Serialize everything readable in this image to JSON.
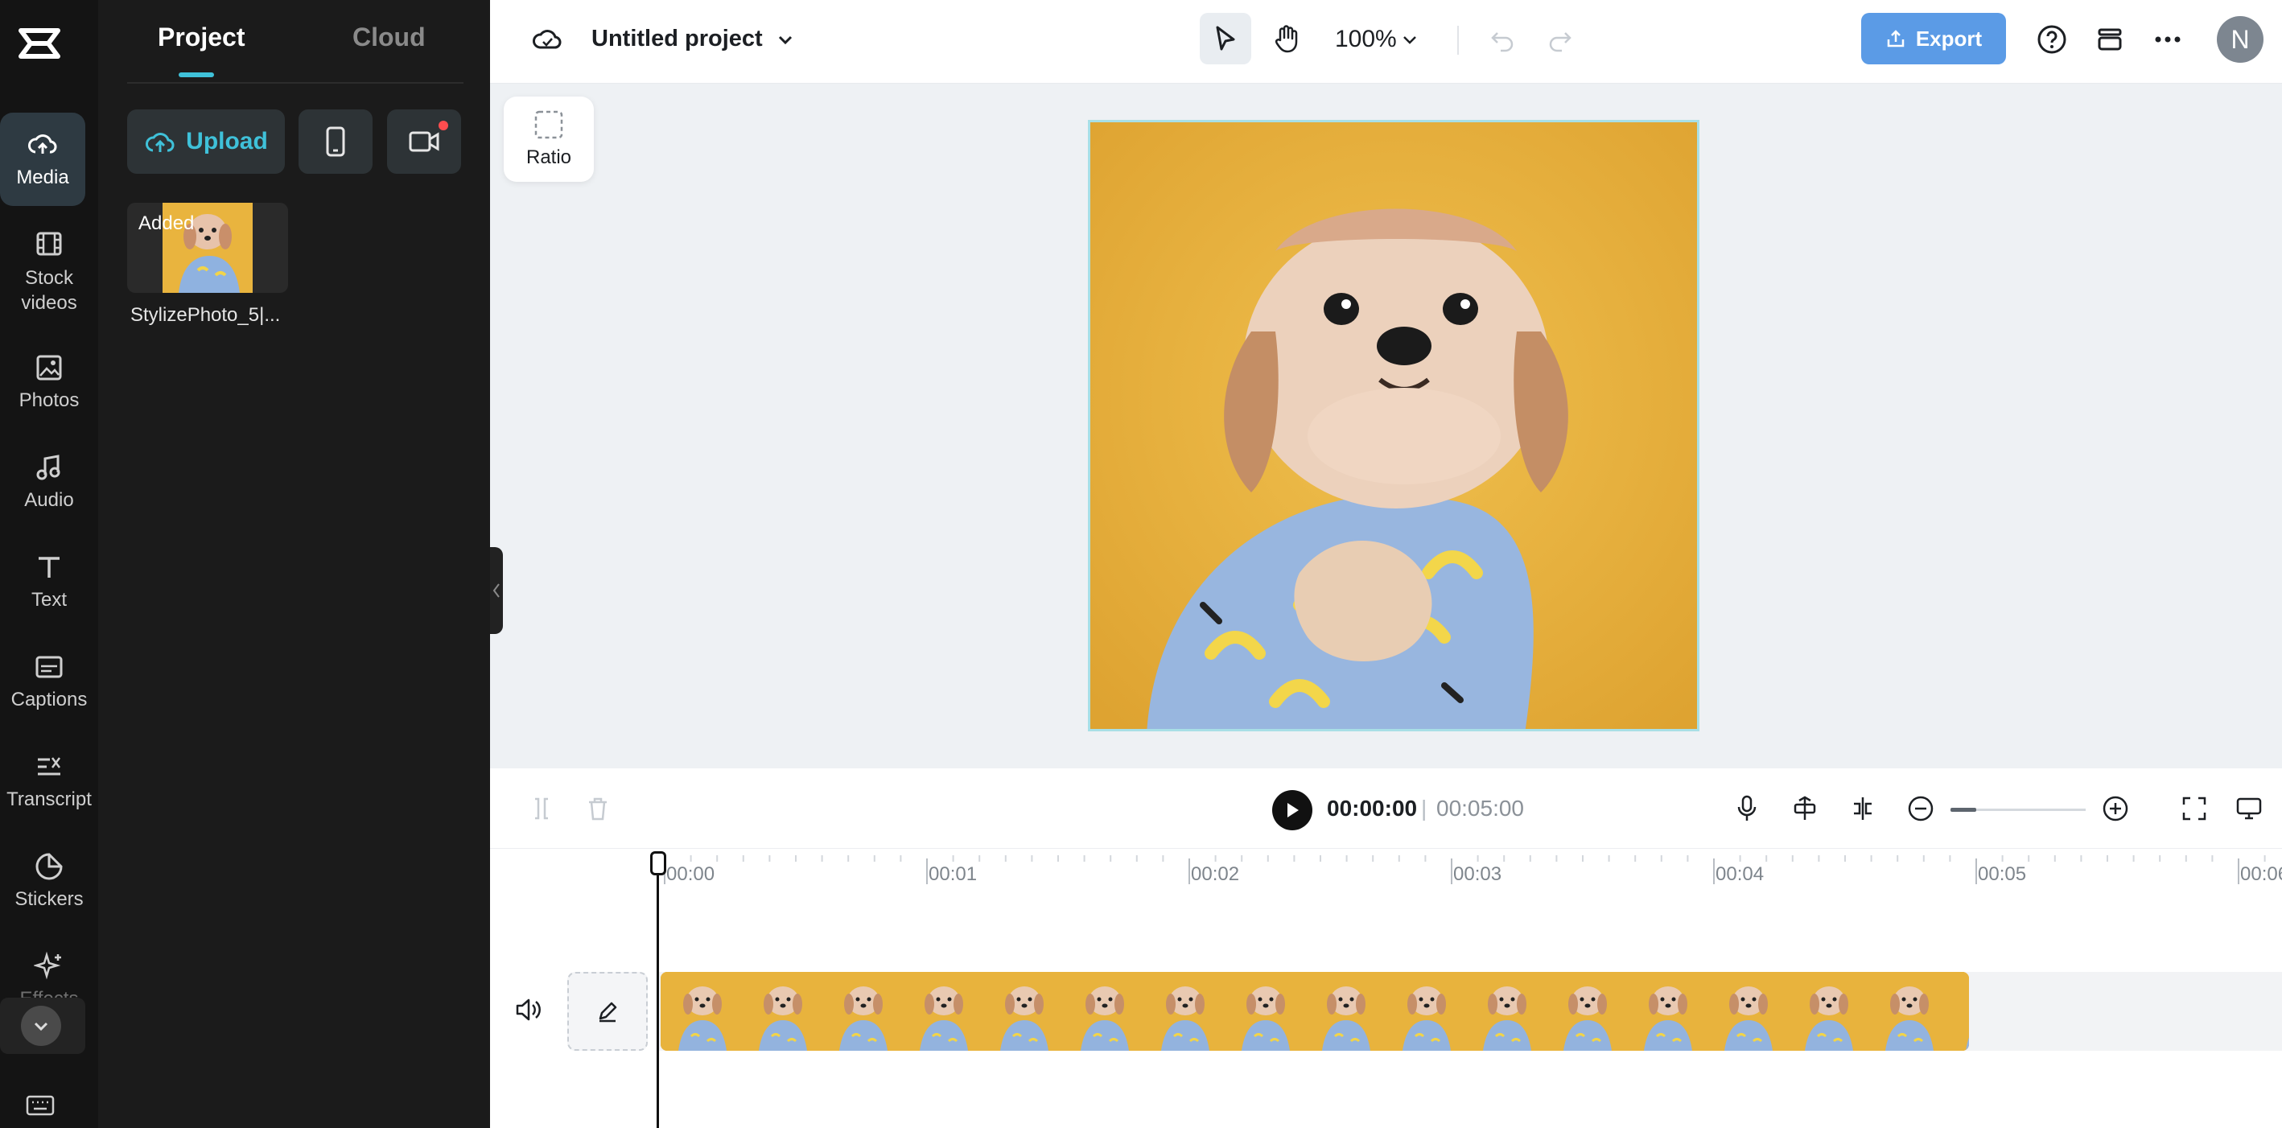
{
  "sidebar": {
    "items": [
      {
        "id": "media",
        "label": "Media",
        "icon": "cloud-upload-icon"
      },
      {
        "id": "stock-videos",
        "label": "Stock\nvideos",
        "icon": "film-icon"
      },
      {
        "id": "photos",
        "label": "Photos",
        "icon": "image-icon"
      },
      {
        "id": "audio",
        "label": "Audio",
        "icon": "music-note-icon"
      },
      {
        "id": "text",
        "label": "Text",
        "icon": "text-t-icon"
      },
      {
        "id": "captions",
        "label": "Captions",
        "icon": "captions-icon"
      },
      {
        "id": "transcript",
        "label": "Transcript",
        "icon": "transcript-icon"
      },
      {
        "id": "stickers",
        "label": "Stickers",
        "icon": "sticker-icon"
      },
      {
        "id": "effects",
        "label": "Effects",
        "icon": "sparkle-icon"
      }
    ],
    "active": "media"
  },
  "media_panel": {
    "tabs": [
      "Project",
      "Cloud"
    ],
    "active_tab": "Project",
    "upload_label": "Upload",
    "assets": [
      {
        "name": "StylizePhoto_5|...",
        "badge": "Added"
      }
    ]
  },
  "topbar": {
    "project_title": "Untitled project",
    "zoom": "100%",
    "export_label": "Export",
    "avatar_initial": "N"
  },
  "canvas": {
    "ratio_label": "Ratio"
  },
  "timeline": {
    "current_time": "00:00:00",
    "separator": "|",
    "total_time": "00:05:00",
    "ruler": [
      "00:00",
      "00:01",
      "00:02",
      "00:03",
      "00:04",
      "00:05",
      "00:06"
    ]
  },
  "colors": {
    "accent": "#3fc1d9",
    "export": "#5b9be6",
    "clip": "#e8b33d"
  }
}
